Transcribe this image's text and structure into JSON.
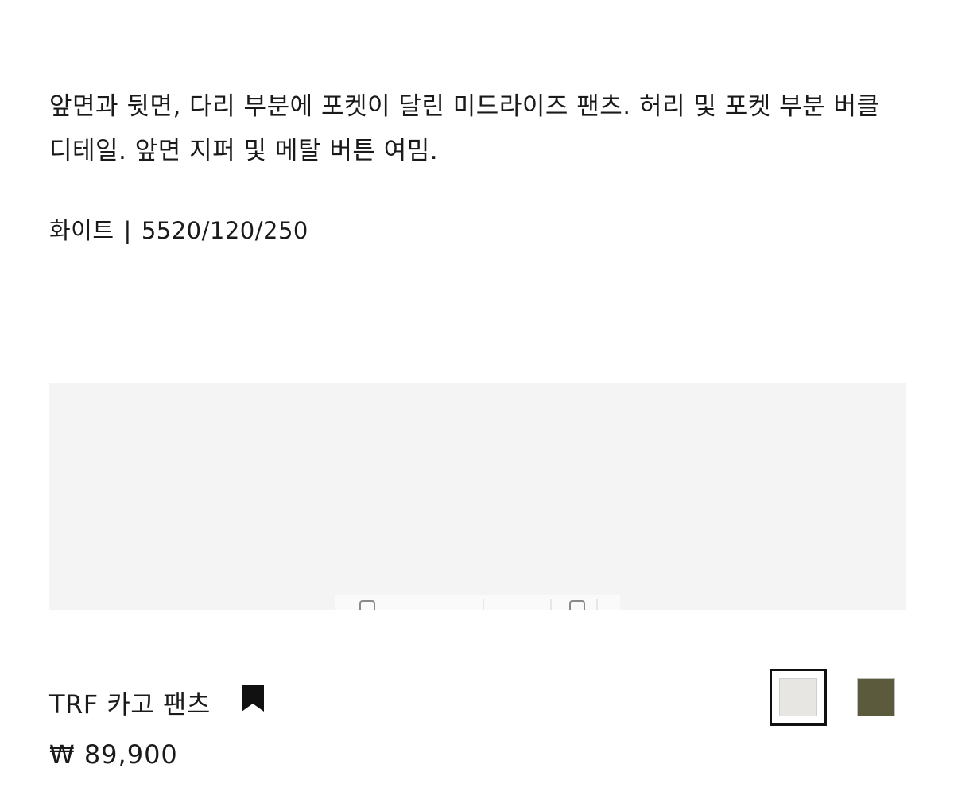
{
  "product": {
    "description": "앞면과 뒷면, 다리 부분에 포켓이 달린 미드라이즈 팬츠. 허리 및 포켓 부분 버클 디테일. 앞면 지퍼 및 메탈 버튼 여밈.",
    "color_name": "화이트",
    "separator": "|",
    "reference": "5520/120/250",
    "name": "TRF 카고 팬츠",
    "price": "₩ 89,900",
    "bookmark_icon": "bookmark-filled-icon"
  },
  "colors": {
    "swatches": [
      {
        "name": "white",
        "hex": "#e8e6e3",
        "selected": true
      },
      {
        "name": "khaki",
        "hex": "#5c5a3d",
        "selected": false
      }
    ],
    "image_background": "#f4f4f4",
    "text": "#1a1a1a"
  }
}
